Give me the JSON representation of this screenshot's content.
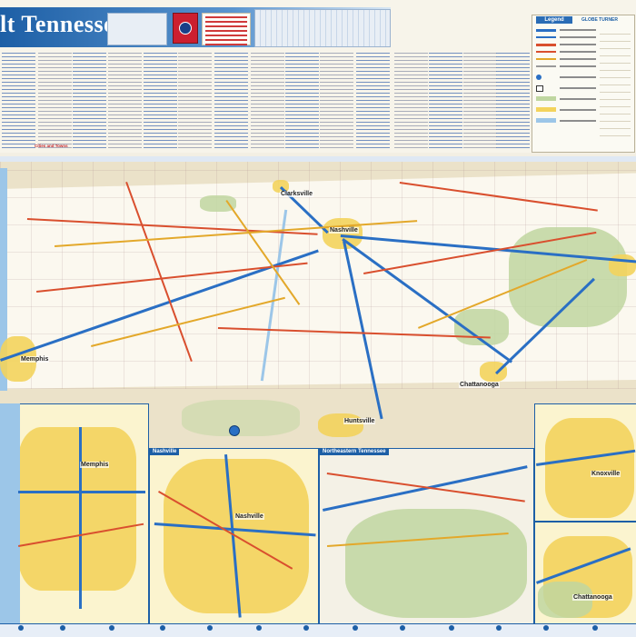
{
  "header": {
    "title": "lt Tennessee",
    "cities_heading": "Cities and Towns",
    "legend_title": "Legend",
    "brand": "GLOBE TURNER"
  },
  "map": {
    "cities": [
      {
        "id": "clarksville",
        "label": "Clarksville"
      },
      {
        "id": "nashville",
        "label": "Nashville"
      },
      {
        "id": "memphis",
        "label": "Memphis"
      },
      {
        "id": "chattanooga",
        "label": "Chattanooga"
      },
      {
        "id": "huntsville",
        "label": "Huntsville"
      }
    ]
  },
  "insets": [
    {
      "title": "",
      "city": "Memphis"
    },
    {
      "title": "Nashville",
      "city": "Nashville"
    },
    {
      "title": "Northeastern Tennessee",
      "city": ""
    },
    {
      "title": "",
      "city": "Knoxville"
    },
    {
      "title": "",
      "city": "Chattanooga"
    }
  ],
  "colors": {
    "accent": "#1d5fa6",
    "interstate": "#2a6fc4",
    "highway": "#d94f2e",
    "urban": "#f3d35c",
    "forest": "#bfd6a0",
    "flag_red": "#cc1f2f"
  }
}
